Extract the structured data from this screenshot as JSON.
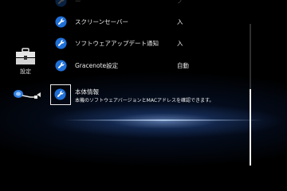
{
  "category": {
    "label": "設定",
    "icon": "toolbox-icon"
  },
  "network_icon": "network-cable-icon",
  "menu": {
    "items": [
      {
        "label": "ー",
        "value": "ノ",
        "icon": "wrench-icon",
        "faded": true
      },
      {
        "label": "スクリーンセーバー",
        "value": "入",
        "icon": "wrench-icon"
      },
      {
        "label": "ソフトウェアアップデート通知",
        "value": "入",
        "icon": "wrench-icon"
      },
      {
        "label": "Gracenote設定",
        "value": "自動",
        "icon": "wrench-icon"
      },
      {
        "label": "本体情報",
        "description": "本機のソフトウェアバージョンとMACアドレスを確認できます。",
        "icon": "wrench-icon",
        "selected": true
      }
    ]
  },
  "colors": {
    "icon_blue": "#1f6fd6",
    "background": "#000000",
    "text": "#eeeeee"
  }
}
